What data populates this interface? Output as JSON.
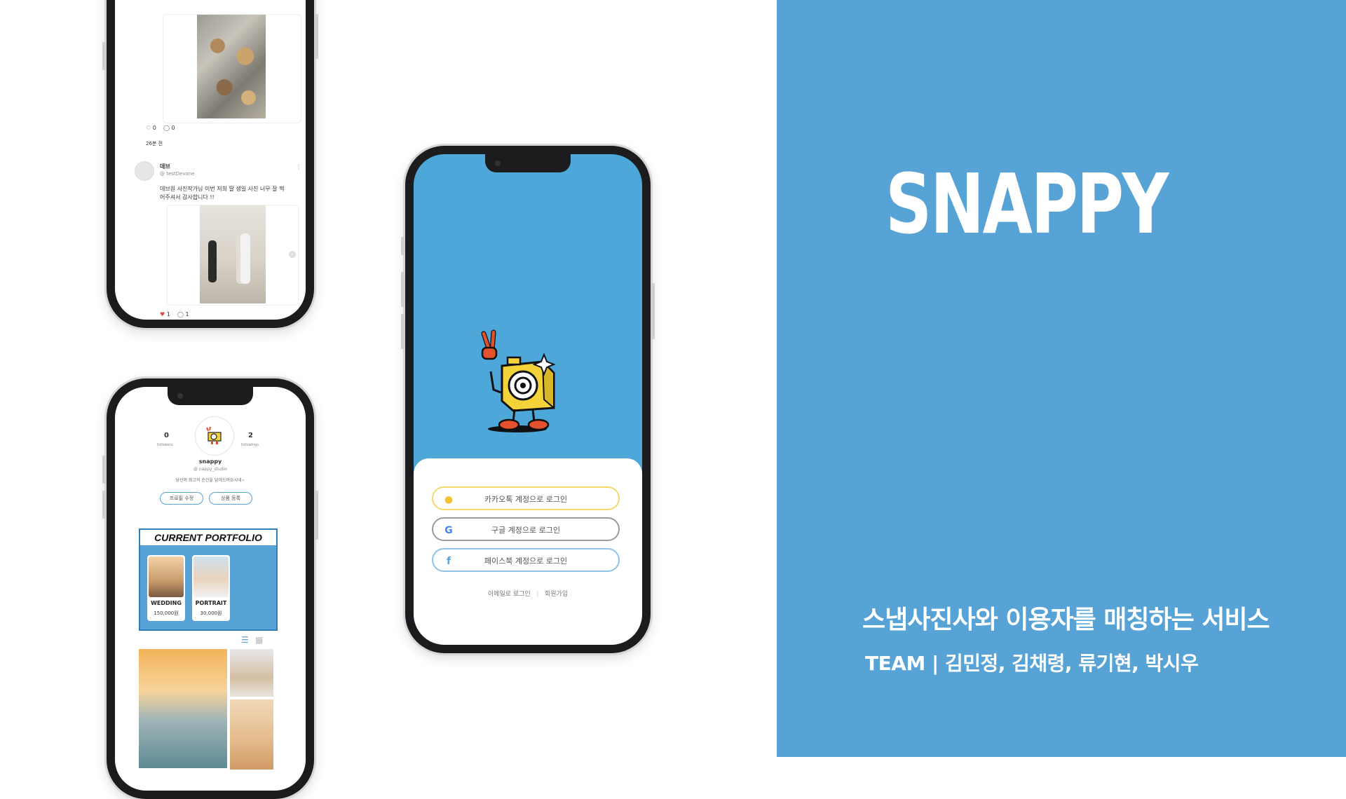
{
  "brand": {
    "title": "SNAPPY",
    "tagline": "스냅사진사와 이용자를 매칭하는 서비스",
    "team": "TEAM | 김민정, 김채령, 류기현, 박시우",
    "accent_color": "#57a3d6"
  },
  "feed_phone": {
    "post1": {
      "likes": "0",
      "comments": "0",
      "time": "26분 전"
    },
    "post2": {
      "author": "데브",
      "handle": "@ testDevone",
      "text_line1": "데브원 사진작가님 이번 저희 딸 생일 사진 너무 잘 찍",
      "text_line2": "어주셔서 감사합니다 !!",
      "likes": "1",
      "comments": "1"
    },
    "icons": [
      "heart-icon",
      "comment-icon",
      "more-icon",
      "chevron-right-icon"
    ]
  },
  "profile_phone": {
    "followers_count": "0",
    "followers_label": "followers",
    "followings_count": "2",
    "followings_label": "followings",
    "name": "snappy",
    "handle": "@ nappy_studio",
    "bio": "당신의 최고의 순간을 담아드려요시네~",
    "edit_profile_button": "프로필 수정",
    "add_product_button": "상품 등록",
    "portfolio_title": "CURRENT PORTFOLIO",
    "portfolio_items": [
      {
        "name": "WEDDING",
        "price": "150,000원"
      },
      {
        "name": "PORTRAIT",
        "price": "30,000원"
      }
    ],
    "icons": [
      "list-view-icon",
      "grid-view-icon"
    ]
  },
  "login_phone": {
    "kakao_button": "카카오톡 계정으로 로그인",
    "google_button": "구글 계정으로 로그인",
    "facebook_button": "페이스북 계정으로 로그인",
    "email_login_link": "이메일로 로그인",
    "divider": "|",
    "signup_link": "회원가입",
    "colors": {
      "kakao": "#f5d86b",
      "google": "#9a9a9a",
      "facebook": "#57a3d6",
      "background": "#4da7d8"
    },
    "icons": [
      "kakao-talk-icon",
      "google-icon",
      "facebook-icon",
      "camera-mascot-icon"
    ]
  }
}
